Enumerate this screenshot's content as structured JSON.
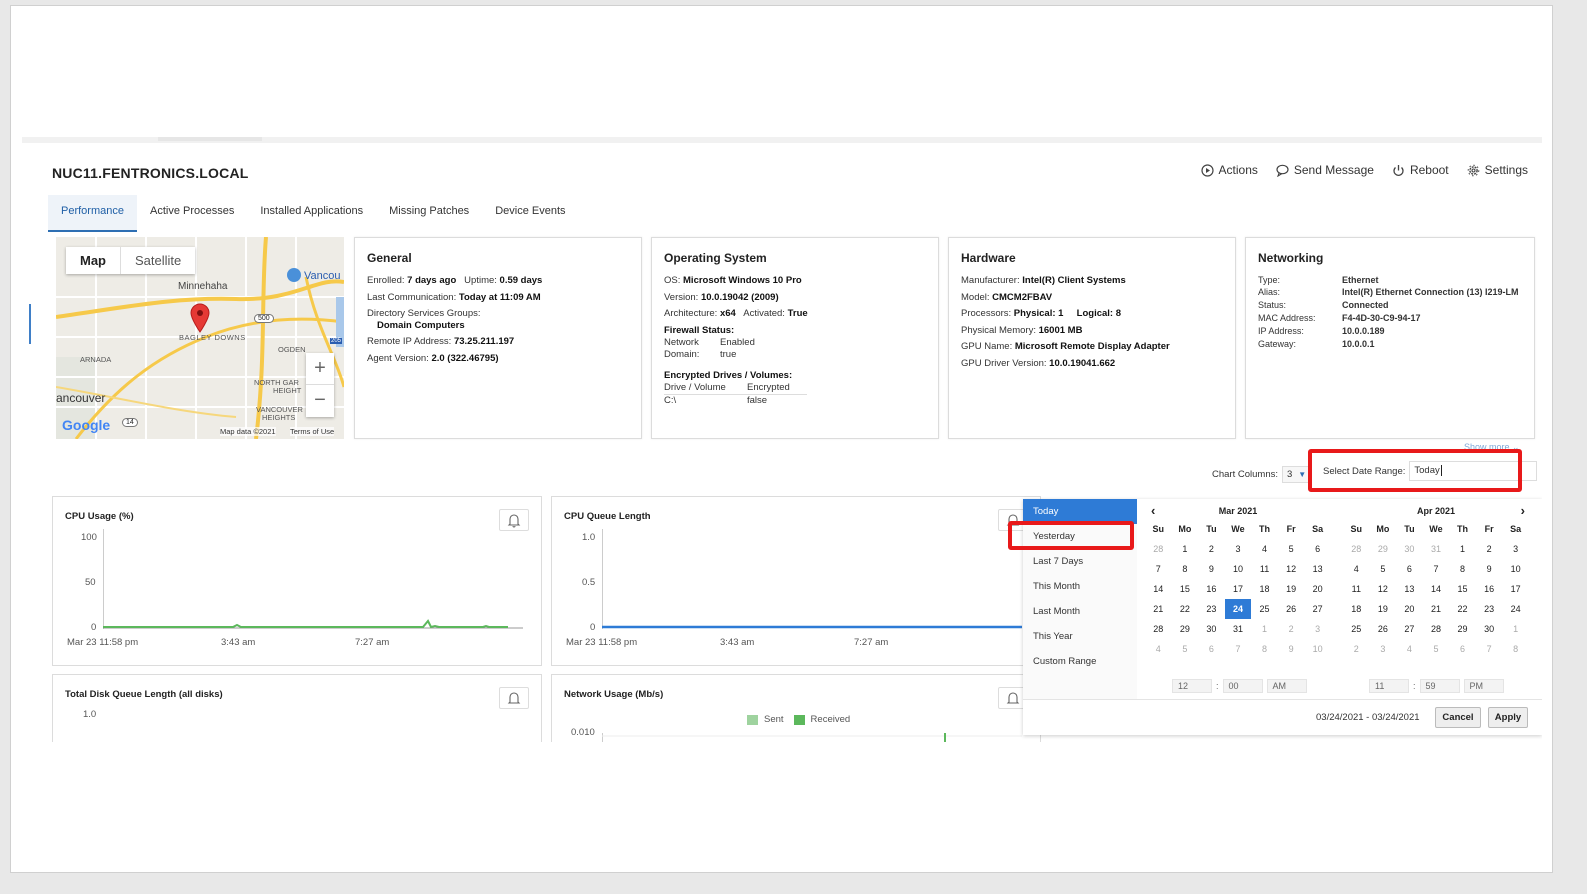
{
  "device": {
    "title": "NUC11.FENTRONICS.LOCAL"
  },
  "actions": [
    {
      "label": "Actions",
      "icon": "play-circle-icon"
    },
    {
      "label": "Send Message",
      "icon": "chat-bubble-icon"
    },
    {
      "label": "Reboot",
      "icon": "power-icon"
    },
    {
      "label": "Settings",
      "icon": "gear-icon"
    }
  ],
  "tabs": [
    "Performance",
    "Active Processes",
    "Installed Applications",
    "Missing Patches",
    "Device Events"
  ],
  "map": {
    "toggle": [
      "Map",
      "Satellite"
    ],
    "labels": [
      "Minnehaha",
      "Vancou",
      "BAGLEY DOWNS",
      "ARNADA",
      "OGDEN",
      "NORTH GAR",
      "HEIGHT",
      "ancouver",
      "VANCOUVER",
      "HEIGHTS",
      "Google",
      "Map data ©2021",
      "Terms of Use",
      "500",
      "205",
      "14"
    ],
    "zoom_in": "+",
    "zoom_out": "−"
  },
  "general": {
    "title": "General",
    "enrolled_label": "Enrolled:",
    "enrolled": "7 days ago",
    "uptime_label": "Uptime:",
    "uptime": "0.59 days",
    "lastcomm_label": "Last Communication:",
    "lastcomm": "Today at 11:09 AM",
    "dsg_label": "Directory Services Groups:",
    "dsg": "Domain Computers",
    "rip_label": "Remote IP Address:",
    "rip": "73.25.211.197",
    "agent_label": "Agent Version:",
    "agent": "2.0 (322.46795)"
  },
  "os": {
    "title": "Operating System",
    "os_label": "OS:",
    "os": "Microsoft Windows 10 Pro",
    "ver_label": "Version:",
    "ver": "10.0.19042 (2009)",
    "arch_label": "Architecture:",
    "arch": "x64",
    "act_label": "Activated:",
    "act": "True",
    "fw_label": "Firewall Status:",
    "fw_rows": [
      [
        "Network",
        "Enabled"
      ],
      [
        "Domain:",
        "true"
      ]
    ],
    "enc_label": "Encrypted Drives / Volumes:",
    "enc_head": [
      "Drive / Volume",
      "Encrypted"
    ],
    "enc_rows": [
      [
        "C:\\",
        "false"
      ]
    ]
  },
  "hardware": {
    "title": "Hardware",
    "man_label": "Manufacturer:",
    "man": "Intel(R) Client Systems",
    "model_label": "Model:",
    "model": "CMCM2FBAV",
    "proc_label": "Processors:",
    "phys_label": "Physical:",
    "phys": "1",
    "log_label": "Logical:",
    "log": "8",
    "mem_label": "Physical Memory:",
    "mem": "16001 MB",
    "gpu_label": "GPU Name:",
    "gpu": "Microsoft Remote Display Adapter",
    "gpud_label": "GPU Driver Version:",
    "gpud": "10.0.19041.662"
  },
  "networking": {
    "title": "Networking",
    "rows": [
      [
        "Type:",
        "Ethernet"
      ],
      [
        "Alias:",
        "Intel(R) Ethernet Connection (13) I219-LM"
      ],
      [
        "Status:",
        "Connected"
      ],
      [
        "MAC Address:",
        "F4-4D-30-C9-94-17"
      ],
      [
        "IP Address:",
        "10.0.0.189"
      ],
      [
        "Gateway:",
        "10.0.0.1"
      ]
    ],
    "show_more": "Show more"
  },
  "controls": {
    "chart_columns_label": "Chart Columns:",
    "chart_columns_value": "3",
    "date_range_label": "Select Date Range:",
    "date_range_value": "Today"
  },
  "charts": {
    "cpu": {
      "title": "CPU Usage (%)",
      "yticks": [
        "100",
        "50",
        "0"
      ],
      "xticks": [
        "Mar 23 11:58 pm",
        "3:43 am",
        "7:27 am"
      ],
      "color": "#5cb85c"
    },
    "queue": {
      "title": "CPU Queue Length",
      "yticks": [
        "1.0",
        "0.5",
        "0"
      ],
      "xticks": [
        "Mar 23 11:58 pm",
        "3:43 am",
        "7:27 am"
      ],
      "color": "#2e7bd6"
    },
    "disk": {
      "title": "Total Disk Queue Length (all disks)",
      "yticks": [
        "1.0"
      ]
    },
    "net": {
      "title": "Network Usage (Mb/s)",
      "yticks": [
        "0.010"
      ],
      "legend": [
        "Sent",
        "Received"
      ],
      "sent_color": "#9fd39f",
      "recv_color": "#5cb85c"
    }
  },
  "picker": {
    "ranges": [
      "Today",
      "Yesterday",
      "Last 7 Days",
      "This Month",
      "Last Month",
      "This Year",
      "Custom Range"
    ],
    "selected_range": "Today",
    "days": [
      "Su",
      "Mo",
      "Tu",
      "We",
      "Th",
      "Fr",
      "Sa"
    ],
    "left_month": "Mar 2021",
    "right_month": "Apr 2021",
    "left_weeks": [
      [
        "28",
        "1",
        "2",
        "3",
        "4",
        "5",
        "6"
      ],
      [
        "7",
        "8",
        "9",
        "10",
        "11",
        "12",
        "13"
      ],
      [
        "14",
        "15",
        "16",
        "17",
        "18",
        "19",
        "20"
      ],
      [
        "21",
        "22",
        "23",
        "24",
        "25",
        "26",
        "27"
      ],
      [
        "28",
        "29",
        "30",
        "31",
        "1",
        "2",
        "3"
      ],
      [
        "4",
        "5",
        "6",
        "7",
        "8",
        "9",
        "10"
      ]
    ],
    "right_weeks": [
      [
        "28",
        "29",
        "30",
        "31",
        "1",
        "2",
        "3"
      ],
      [
        "4",
        "5",
        "6",
        "7",
        "8",
        "9",
        "10"
      ],
      [
        "11",
        "12",
        "13",
        "14",
        "15",
        "16",
        "17"
      ],
      [
        "18",
        "19",
        "20",
        "21",
        "22",
        "23",
        "24"
      ],
      [
        "25",
        "26",
        "27",
        "28",
        "29",
        "30",
        "1"
      ],
      [
        "2",
        "3",
        "4",
        "5",
        "6",
        "7",
        "8"
      ]
    ],
    "start_time": {
      "h": "12",
      "m": "00",
      "ampm": "AM"
    },
    "end_time": {
      "h": "11",
      "m": "59",
      "ampm": "PM"
    },
    "summary": "03/24/2021 - 03/24/2021",
    "cancel": "Cancel",
    "apply": "Apply",
    "accent": "#2e7bd6"
  },
  "highlight_color": "#e8191a"
}
